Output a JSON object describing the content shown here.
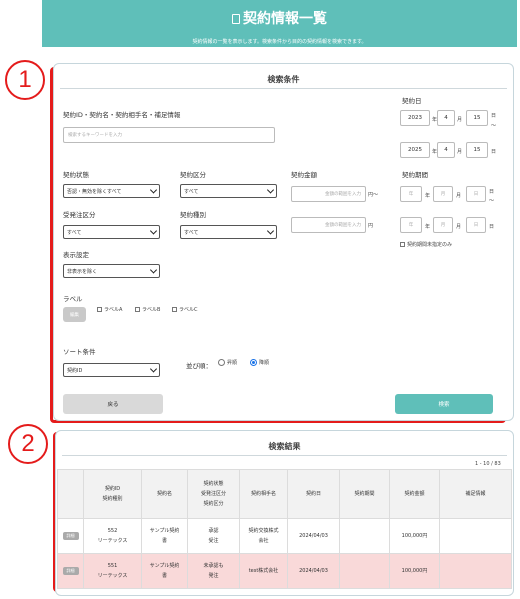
{
  "header": {
    "icon": "document-icon",
    "title": "契約情報一覧",
    "subtitle": "契約情報の一覧を表示します。検索条件から目的の契約情報を検索できます。"
  },
  "callouts": {
    "one": "1",
    "two": "2"
  },
  "search": {
    "title": "検索条件",
    "keyword": {
      "label": "契約ID・契約名・契約相手名・補足情報",
      "placeholder": "検索するキーワードを入力"
    },
    "contract_date": {
      "label": "契約日",
      "from": {
        "year": "2023",
        "year_unit": "年",
        "month": "4",
        "month_unit": "月",
        "day": "15",
        "day_unit": "日",
        "tilde": "〜"
      },
      "to": {
        "year": "2025",
        "year_unit": "年",
        "month": "4",
        "month_unit": "月",
        "day": "15",
        "day_unit": "日"
      }
    },
    "status": {
      "label": "契約状態",
      "value": "否認・無効を除くすべて"
    },
    "category": {
      "label": "契約区分",
      "value": "すべて"
    },
    "amount": {
      "label": "契約金額",
      "placeholder_from": "金額の範囲を入力",
      "unit_from": "円〜",
      "placeholder_to": "金額の範囲を入力",
      "unit_to": "円"
    },
    "period": {
      "label": "契約期間",
      "from": {
        "year": "年",
        "year_unit": "年",
        "month": "月",
        "month_unit": "月",
        "day": "日",
        "day_unit": "日",
        "tilde": "〜"
      },
      "to": {
        "year": "年",
        "year_unit": "年",
        "month": "月",
        "month_unit": "月",
        "day": "日",
        "day_unit": "日"
      },
      "unset_label": "契約期間未指定のみ"
    },
    "order_type": {
      "label": "受発注区分",
      "value": "すべて"
    },
    "contract_kind": {
      "label": "契約種別",
      "value": "すべて"
    },
    "display": {
      "label": "表示設定",
      "value": "非表示を除く"
    },
    "labels": {
      "label": "ラベル",
      "edit": "編集",
      "items": [
        "ラベルA",
        "ラベルB",
        "ラベルC"
      ]
    },
    "sort": {
      "label": "ソート条件",
      "value": "契約ID",
      "order_label": "並び順：",
      "asc": "昇順",
      "desc": "降順"
    },
    "back_button": "戻る",
    "search_button": "検索"
  },
  "results": {
    "title": "検索結果",
    "count": "1 - 10 / 83",
    "headers": {
      "id": [
        "契約ID",
        "契約種別"
      ],
      "name": "契約名",
      "status": [
        "契約状態",
        "受発注区分",
        "契約区分"
      ],
      "partner": "契約相手名",
      "date": "契約日",
      "period": "契約期間",
      "amount": "契約金額",
      "note": "補足情報"
    },
    "rows": [
      {
        "detail": "詳細",
        "id": "552",
        "kind": "リーテックス",
        "name": [
          "サンプル契約",
          "書"
        ],
        "status": [
          "承認",
          "受注"
        ],
        "partner": [
          "契約交換株式",
          "会社"
        ],
        "date": "2024/04/03",
        "period": "",
        "amount": "100,000円",
        "note": ""
      },
      {
        "detail": "詳細",
        "id": "551",
        "kind": "リーテックス",
        "name": [
          "サンプル契約",
          "書"
        ],
        "status": [
          "未承認も",
          "発注"
        ],
        "partner": [
          "test株式会社"
        ],
        "date": "2024/04/03",
        "period": "",
        "amount": "100,000円",
        "note": ""
      }
    ]
  },
  "colors": {
    "accent": "#5fbfb9",
    "highlight_box": "#e41b1b",
    "row_highlight": "#f9d9d9"
  }
}
